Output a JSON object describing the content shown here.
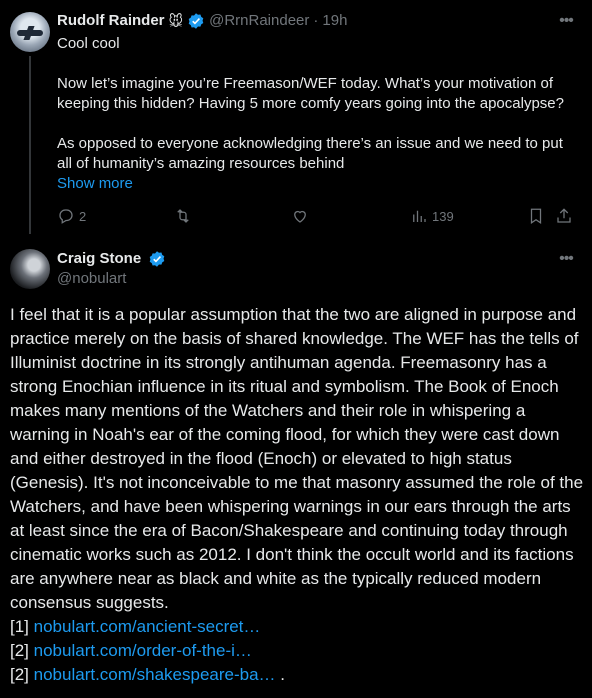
{
  "reply": {
    "name": "Rudolf Rainder",
    "name_emoji": "🐭",
    "handle": "@RrnRaindeer",
    "dot": "·",
    "time": "19h",
    "lines": [
      "Cool cool",
      "Now let’s imagine you’re Freemason/WEF today. What’s your motivation of keeping this hidden? Having 5 more comfy years going into the apocalypse?",
      "As opposed to everyone acknowledging there’s an issue and we need to put all of humanity’s amazing resources behind"
    ],
    "show_more": "Show more",
    "actions": {
      "replies": "2",
      "reposts": "",
      "likes": "",
      "views": "139"
    },
    "icons": [
      "reply-icon",
      "repost-icon",
      "like-icon",
      "views-icon",
      "bookmark-icon",
      "share-icon",
      "more-icon"
    ]
  },
  "main": {
    "name": "Craig Stone",
    "handle": "@nobulart",
    "text": "I feel that it is a popular assumption that the two are aligned in purpose and practice merely on the basis of shared knowledge. The WEF has the tells of Illuminist doctrine in its strongly antihuman agenda. Freemasonry has a strong Enochian influence in its ritual and symbolism. The Book of Enoch makes many mentions of the Watchers and their role in whispering a warning in Noah's ear of the coming flood, for which they were cast down and either destroyed in the flood (Enoch) or elevated to high status (Genesis). It's not inconceivable to me that masonry assumed the role of the Watchers, and have been whispering warnings in our ears through the arts at least since the era of Bacon/Shakespeare and continuing today through cinematic works such as 2012. I don't think the occult world and its factions are anywhere near as black and white as the typically reduced modern consensus suggests.",
    "refs": [
      {
        "prefix": "[1]",
        "link": "nobulart.com/ancient-secret…",
        "suffix": ""
      },
      {
        "prefix": "[2]",
        "link": "nobulart.com/order-of-the-i…",
        "suffix": ""
      },
      {
        "prefix": "[2]",
        "link": "nobulart.com/shakespeare-ba…",
        "suffix": " ."
      }
    ]
  },
  "colors": {
    "background": "#000000",
    "text": "#e7e9ea",
    "muted": "#71767b",
    "link": "#1d9bf0",
    "verified": "#1d9bf0"
  }
}
